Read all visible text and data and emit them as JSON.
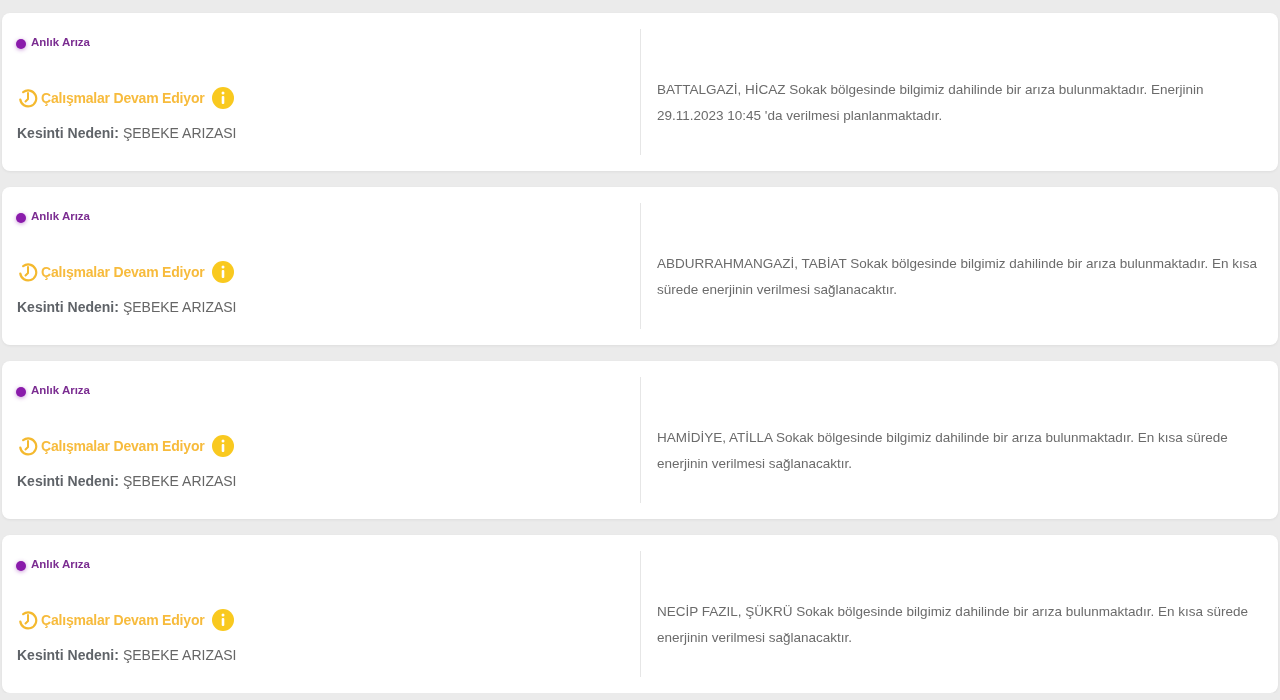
{
  "outages": [
    {
      "type_label": "Anlık Arıza",
      "status": "Çalışmalar Devam Ediyor",
      "reason_label": "Kesinti Nedeni:",
      "reason": "ŞEBEKE ARIZASI",
      "description": "BATTALGAZİ, HİCAZ Sokak bölgesinde bilgimiz dahilinde bir arıza bulunmaktadır. Enerjinin 29.11.2023 10:45 'da verilmesi planlanmaktadır."
    },
    {
      "type_label": "Anlık Arıza",
      "status": "Çalışmalar Devam Ediyor",
      "reason_label": "Kesinti Nedeni:",
      "reason": "ŞEBEKE ARIZASI",
      "description": "ABDURRAHMANGAZİ, TABİAT Sokak bölgesinde bilgimiz dahilinde bir arıza bulunmaktadır. En kısa sürede enerjinin verilmesi sağlanacaktır."
    },
    {
      "type_label": "Anlık Arıza",
      "status": "Çalışmalar Devam Ediyor",
      "reason_label": "Kesinti Nedeni:",
      "reason": "ŞEBEKE ARIZASI",
      "description": "HAMİDİYE, ATİLLA Sokak bölgesinde bilgimiz dahilinde bir arıza bulunmaktadır. En kısa sürede enerjinin verilmesi sağlanacaktır."
    },
    {
      "type_label": "Anlık Arıza",
      "status": "Çalışmalar Devam Ediyor",
      "reason_label": "Kesinti Nedeni:",
      "reason": "ŞEBEKE ARIZASI",
      "description": "NECİP FAZIL, ŞÜKRÜ Sokak bölgesinde bilgimiz dahilinde bir arıza bulunmaktadır. En kısa sürede enerjinin verilmesi sağlanacaktır."
    }
  ]
}
